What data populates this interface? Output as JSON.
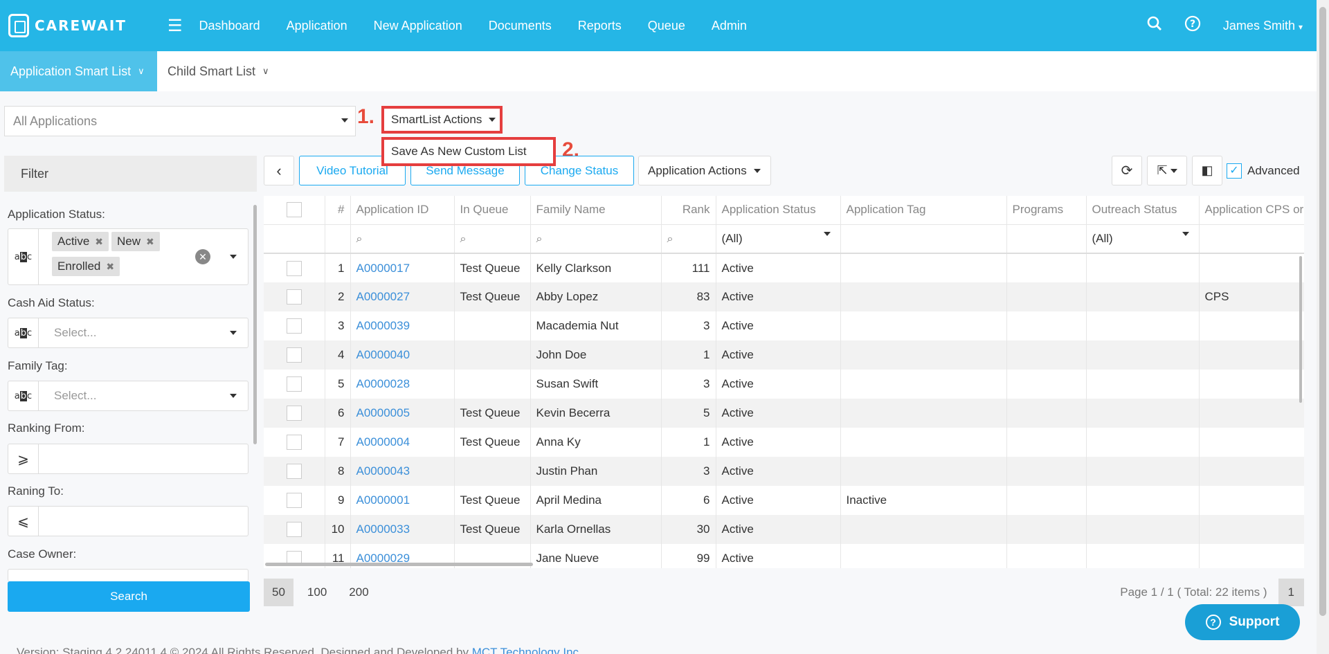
{
  "brand": {
    "name": "CAREWAIT"
  },
  "nav": {
    "items": [
      "Dashboard",
      "Application",
      "New Application",
      "Documents",
      "Reports",
      "Queue",
      "Admin"
    ],
    "user": "James Smith"
  },
  "tabs": [
    {
      "label": "Application Smart List"
    },
    {
      "label": "Child Smart List"
    }
  ],
  "list_select": {
    "value": "All Applications"
  },
  "annotations": {
    "step1": "1.",
    "step2": "2."
  },
  "smartlist": {
    "button_label": "SmartList Actions",
    "menu_item": "Save As New Custom List"
  },
  "filter": {
    "header": "Filter",
    "application_status_label": "Application Status:",
    "application_status_tags": [
      "Active",
      "New",
      "Enrolled"
    ],
    "cash_aid_label": "Cash Aid Status:",
    "cash_aid_placeholder": "Select...",
    "family_tag_label": "Family Tag:",
    "family_tag_placeholder": "Select...",
    "ranking_from_label": "Ranking From:",
    "ranking_to_label": "Raning To:",
    "case_owner_label": "Case Owner:",
    "search_button": "Search"
  },
  "toolbar": {
    "video_tutorial": "Video Tutorial",
    "send_message": "Send Message",
    "change_status": "Change Status",
    "application_actions": "Application Actions",
    "advanced": "Advanced"
  },
  "table": {
    "columns": [
      "#",
      "Application ID",
      "In Queue",
      "Family Name",
      "Rank",
      "Application Status",
      "Application Tag",
      "Programs",
      "Outreach Status",
      "Application CPS or"
    ],
    "filter_all": "(All)",
    "rows": [
      {
        "n": "1",
        "id": "A0000017",
        "queue": "Test Queue",
        "family": "Kelly Clarkson",
        "rank": "111",
        "status": "Active",
        "tag": "",
        "programs": "",
        "outreach": "",
        "cps": ""
      },
      {
        "n": "2",
        "id": "A0000027",
        "queue": "Test Queue",
        "family": "Abby Lopez",
        "rank": "83",
        "status": "Active",
        "tag": "",
        "programs": "",
        "outreach": "",
        "cps": "CPS"
      },
      {
        "n": "3",
        "id": "A0000039",
        "queue": "",
        "family": "Macademia Nut",
        "rank": "3",
        "status": "Active",
        "tag": "",
        "programs": "",
        "outreach": "",
        "cps": ""
      },
      {
        "n": "4",
        "id": "A0000040",
        "queue": "",
        "family": "John Doe",
        "rank": "1",
        "status": "Active",
        "tag": "",
        "programs": "",
        "outreach": "",
        "cps": ""
      },
      {
        "n": "5",
        "id": "A0000028",
        "queue": "",
        "family": "Susan Swift",
        "rank": "3",
        "status": "Active",
        "tag": "",
        "programs": "",
        "outreach": "",
        "cps": ""
      },
      {
        "n": "6",
        "id": "A0000005",
        "queue": "Test Queue",
        "family": "Kevin Becerra",
        "rank": "5",
        "status": "Active",
        "tag": "",
        "programs": "",
        "outreach": "",
        "cps": ""
      },
      {
        "n": "7",
        "id": "A0000004",
        "queue": "Test Queue",
        "family": "Anna Ky",
        "rank": "1",
        "status": "Active",
        "tag": "",
        "programs": "",
        "outreach": "",
        "cps": ""
      },
      {
        "n": "8",
        "id": "A0000043",
        "queue": "",
        "family": "Justin Phan",
        "rank": "3",
        "status": "Active",
        "tag": "",
        "programs": "",
        "outreach": "",
        "cps": ""
      },
      {
        "n": "9",
        "id": "A0000001",
        "queue": "Test Queue",
        "family": "April Medina",
        "rank": "6",
        "status": "Active",
        "tag": "Inactive",
        "programs": "",
        "outreach": "",
        "cps": ""
      },
      {
        "n": "10",
        "id": "A0000033",
        "queue": "Test Queue",
        "family": "Karla Ornellas",
        "rank": "30",
        "status": "Active",
        "tag": "",
        "programs": "",
        "outreach": "",
        "cps": ""
      },
      {
        "n": "11",
        "id": "A0000029",
        "queue": "",
        "family": "Jane Nueve",
        "rank": "99",
        "status": "Active",
        "tag": "",
        "programs": "",
        "outreach": "",
        "cps": ""
      }
    ]
  },
  "pager": {
    "sizes": [
      "50",
      "100",
      "200"
    ],
    "info": "Page 1 / 1 ( Total: 22 items )",
    "page": "1"
  },
  "support": {
    "label": "Support"
  },
  "footer": {
    "text": "Version: Staging 4.2.24011.4 © 2024 All Rights Reserved. Designed and Developed by ",
    "link": "MCT Technology Inc"
  }
}
